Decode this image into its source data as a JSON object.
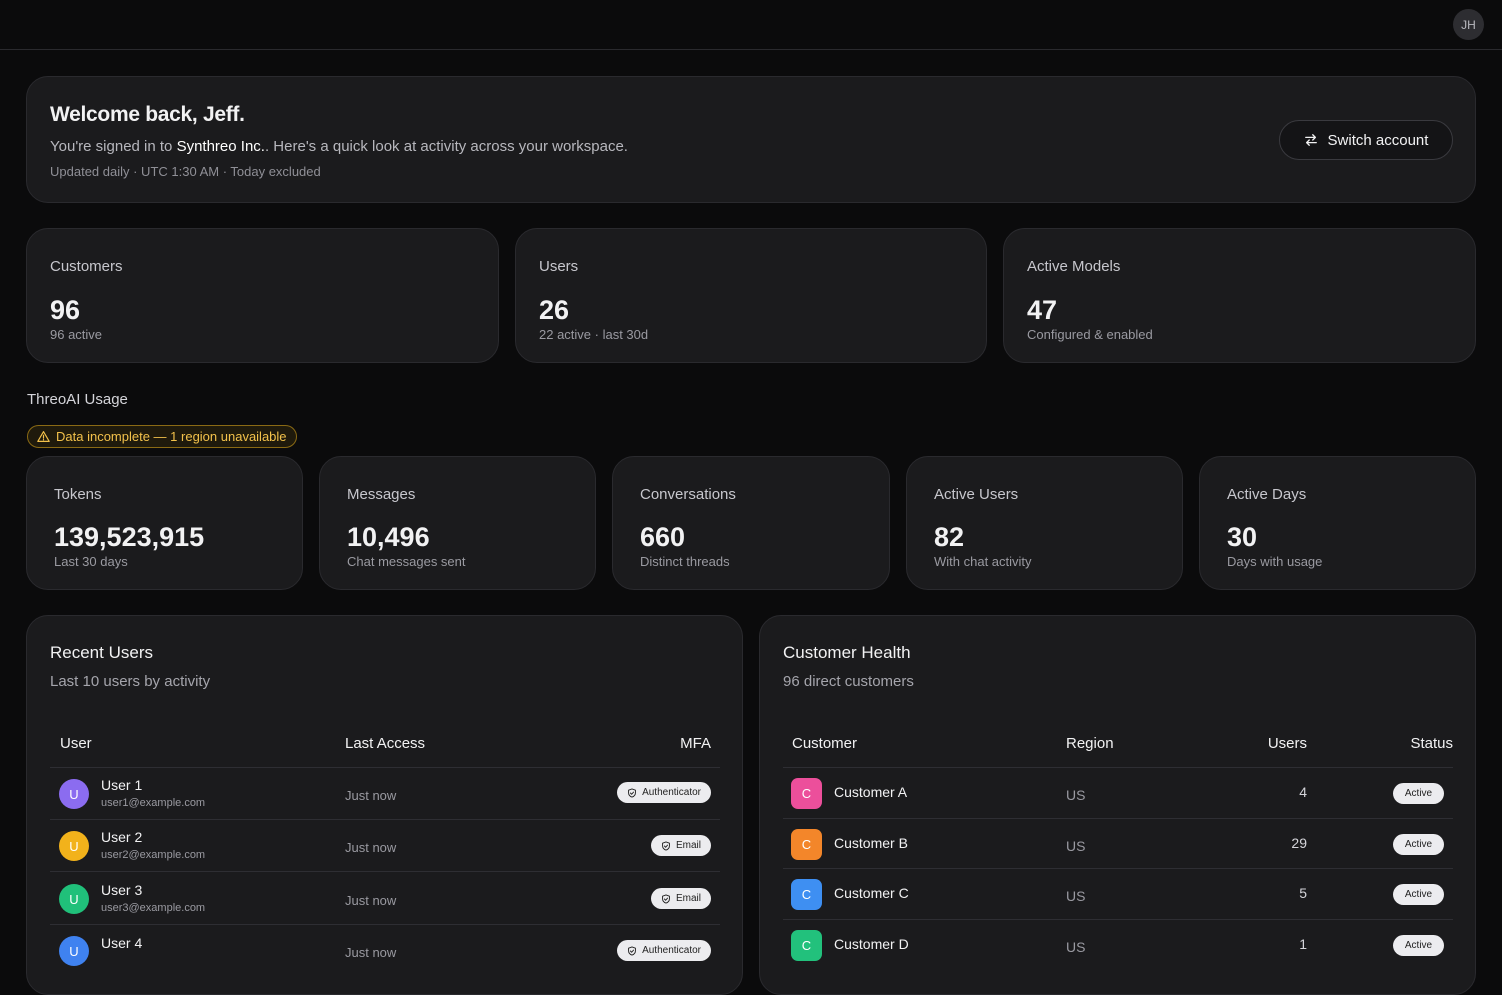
{
  "topbar": {
    "avatar_initials": "JH"
  },
  "welcome": {
    "title": "Welcome back, Jeff.",
    "sub_prefix": "You're signed in to ",
    "org": "Synthreo Inc.",
    "sub_suffix": ". Here's a quick look at activity across your workspace.",
    "meta": "Updated daily · UTC 1:30 AM · Today excluded",
    "switch_label": "Switch account"
  },
  "stats": [
    {
      "label": "Customers",
      "value": "96",
      "note": "96 active"
    },
    {
      "label": "Users",
      "value": "26",
      "note": "22 active · last 30d"
    },
    {
      "label": "Active Models",
      "value": "47",
      "note": "Configured & enabled"
    }
  ],
  "usage": {
    "title": "ThreoAI Usage",
    "warning": "Data incomplete — 1 region unavailable",
    "cards": [
      {
        "label": "Tokens",
        "value": "139,523,915",
        "note": "Last 30 days"
      },
      {
        "label": "Messages",
        "value": "10,496",
        "note": "Chat messages sent"
      },
      {
        "label": "Conversations",
        "value": "660",
        "note": "Distinct threads"
      },
      {
        "label": "Active Users",
        "value": "82",
        "note": "With chat activity"
      },
      {
        "label": "Active Days",
        "value": "30",
        "note": "Days with usage"
      }
    ]
  },
  "recent_users": {
    "title": "Recent Users",
    "subtitle": "Last 10 users by activity",
    "columns": [
      "User",
      "Last Access",
      "MFA"
    ],
    "rows": [
      {
        "initial": "U",
        "name": "User 1",
        "email": "user1@example.com",
        "last_access": "Just now",
        "mfa": "Authenticator",
        "color": "#8b6cf0"
      },
      {
        "initial": "U",
        "name": "User 2",
        "email": "user2@example.com",
        "last_access": "Just now",
        "mfa": "Email",
        "color": "#f2b21b"
      },
      {
        "initial": "U",
        "name": "User 3",
        "email": "user3@example.com",
        "last_access": "Just now",
        "mfa": "Email",
        "color": "#20c07a"
      },
      {
        "initial": "U",
        "name": "User 4",
        "email": "",
        "last_access": "Just now",
        "mfa": "Authenticator",
        "color": "#3f82f0"
      }
    ]
  },
  "customer_health": {
    "title": "Customer Health",
    "subtitle": "96 direct customers",
    "columns": [
      "Customer",
      "Region",
      "Users",
      "Status"
    ],
    "rows": [
      {
        "initial": "C",
        "name": "Customer A",
        "region": "US",
        "users": "4",
        "status": "Active",
        "color": "#ec4f9b"
      },
      {
        "initial": "C",
        "name": "Customer B",
        "region": "US",
        "users": "29",
        "status": "Active",
        "color": "#f3862a"
      },
      {
        "initial": "C",
        "name": "Customer C",
        "region": "US",
        "users": "5",
        "status": "Active",
        "color": "#3e8ff2"
      },
      {
        "initial": "C",
        "name": "Customer D",
        "region": "US",
        "users": "1",
        "status": "Active",
        "color": "#22c17c"
      }
    ]
  }
}
